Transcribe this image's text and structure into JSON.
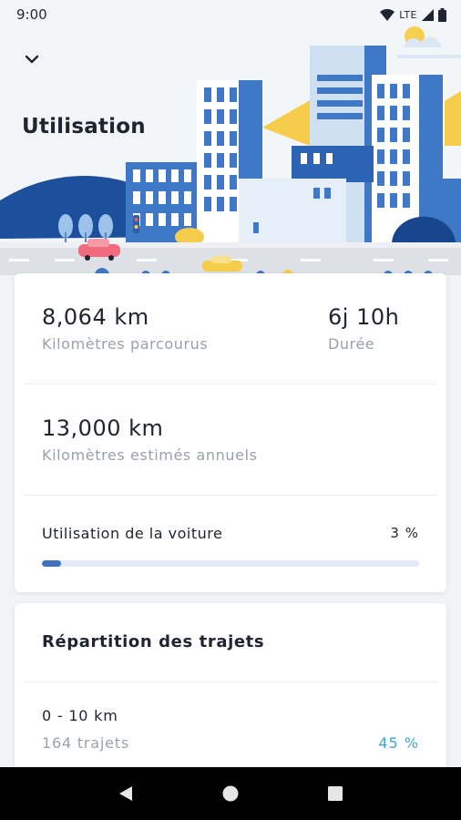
{
  "status_bar": {
    "time": "9:00",
    "network": "LTE",
    "icons": [
      "wifi-icon",
      "signal-icon",
      "battery-icon"
    ]
  },
  "header": {
    "title": "Utilisation",
    "back_icon": "chevron-down-icon"
  },
  "stats": {
    "distance_value": "8,064 km",
    "distance_label": "Kilomètres parcourus",
    "duration_value": "6j 10h",
    "duration_label": "Durée",
    "annual_value": "13,000 km",
    "annual_label": "Kilomètres estimés annuels",
    "usage_label": "Utilisation de la voiture",
    "usage_pct_text": "3 %",
    "usage_fraction": 0.05
  },
  "trips": {
    "title": "Répartition des trajets",
    "items": [
      {
        "range": "0 - 10 km",
        "count": "164 trajets",
        "pct": "45 %"
      }
    ]
  },
  "nav": {
    "back": "back-triangle-icon",
    "home": "home-circle-icon",
    "recents": "recents-square-icon"
  },
  "colors": {
    "accent": "#3f6fbe",
    "percent": "#3aa6cf",
    "muted": "#9aa1ad",
    "text": "#1f2430"
  }
}
